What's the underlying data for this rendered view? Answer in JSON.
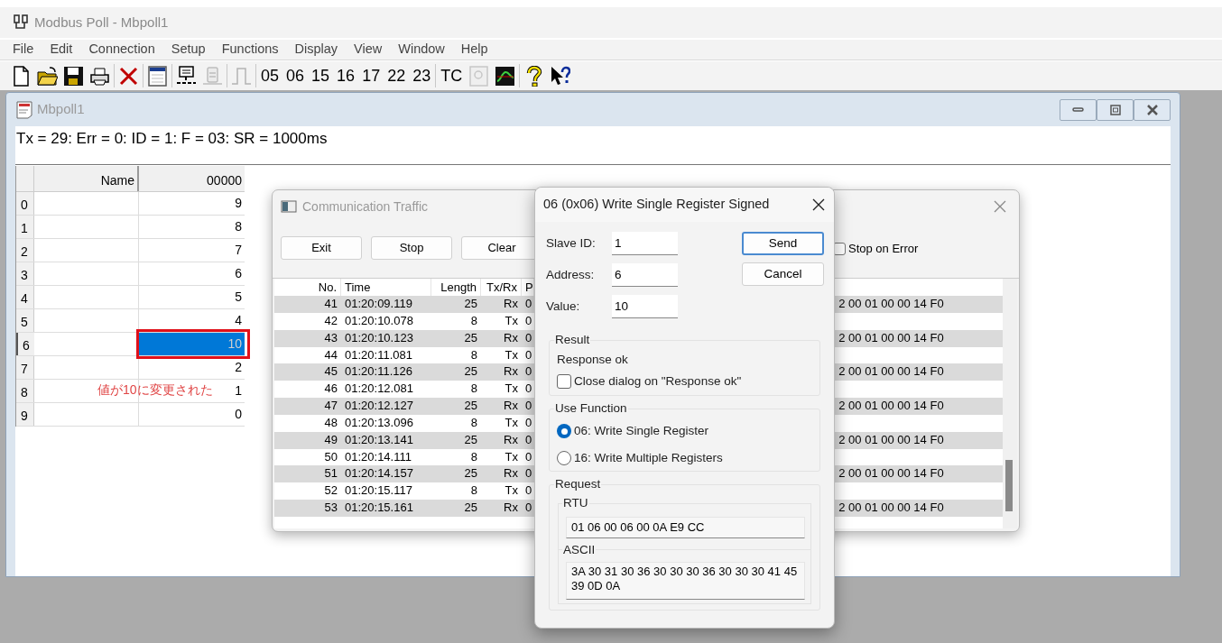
{
  "app": {
    "title": "Modbus Poll - Mbpoll1"
  },
  "menu": [
    "File",
    "Edit",
    "Connection",
    "Setup",
    "Functions",
    "Display",
    "View",
    "Window",
    "Help"
  ],
  "toolbar_groups": [
    {
      "items": [
        {
          "kind": "document",
          "disabled": false
        },
        {
          "kind": "folder",
          "disabled": false
        },
        {
          "kind": "disk",
          "disabled": false
        },
        {
          "kind": "printer",
          "disabled": false
        }
      ]
    },
    {
      "items": [
        {
          "kind": "delete",
          "disabled": false
        }
      ]
    },
    {
      "items": [
        {
          "kind": "window",
          "disabled": false
        }
      ]
    },
    {
      "items": [
        {
          "kind": "connect",
          "disabled": false
        },
        {
          "kind": "disconnect",
          "disabled": true
        }
      ]
    },
    {
      "items": [
        {
          "kind": "pulse",
          "disabled": true
        }
      ]
    },
    {
      "items": [
        {
          "kind": "code",
          "label": "05",
          "disabled": false
        },
        {
          "kind": "code",
          "label": "06",
          "disabled": false
        },
        {
          "kind": "code",
          "label": "15",
          "disabled": false
        },
        {
          "kind": "code",
          "label": "16",
          "disabled": false
        },
        {
          "kind": "code",
          "label": "17",
          "disabled": false
        },
        {
          "kind": "code",
          "label": "22",
          "disabled": false
        },
        {
          "kind": "code",
          "label": "23",
          "disabled": false
        }
      ]
    },
    {
      "items": [
        {
          "kind": "code",
          "label": "TC",
          "disabled": false
        },
        {
          "kind": "monitor",
          "disabled": true
        },
        {
          "kind": "chart",
          "disabled": false
        }
      ]
    },
    {
      "items": [
        {
          "kind": "help",
          "disabled": false
        },
        {
          "kind": "context-help",
          "disabled": false
        }
      ]
    }
  ],
  "poll_window": {
    "title": "Mbpoll1",
    "status": "Tx = 29: Err = 0: ID = 1: F = 03: SR = 1000ms",
    "columns": [
      "Name",
      "00000"
    ],
    "rows": [
      {
        "index": "0",
        "value": "9",
        "selected": false,
        "highlighted": false
      },
      {
        "index": "1",
        "value": "8",
        "selected": false,
        "highlighted": false
      },
      {
        "index": "2",
        "value": "7",
        "selected": false,
        "highlighted": false
      },
      {
        "index": "3",
        "value": "6",
        "selected": false,
        "highlighted": false
      },
      {
        "index": "4",
        "value": "5",
        "selected": false,
        "highlighted": false
      },
      {
        "index": "5",
        "value": "4",
        "selected": false,
        "highlighted": false
      },
      {
        "index": "6",
        "value": "10",
        "selected": true,
        "highlighted": true
      },
      {
        "index": "7",
        "value": "2",
        "selected": false,
        "highlighted": false
      },
      {
        "index": "8",
        "value": "1",
        "selected": false,
        "highlighted": false
      },
      {
        "index": "9",
        "value": "0",
        "selected": false,
        "highlighted": false
      }
    ],
    "annotation": "値が10に変更された"
  },
  "traffic_window": {
    "title": "Communication Traffic",
    "buttons": [
      "Exit",
      "Stop",
      "Clear"
    ],
    "stop_on_error": {
      "label": "Stop on Error",
      "checked": false
    },
    "columns": [
      "No.",
      "Time",
      "Length",
      "Tx/Rx",
      "P"
    ],
    "rows": [
      {
        "no": "41",
        "time": "01:20:09.119",
        "length": "25",
        "dir": "Rx",
        "payload_start": "0",
        "payload_end": "2 00 01 00 00 14 F0"
      },
      {
        "no": "42",
        "time": "01:20:10.078",
        "length": "8",
        "dir": "Tx",
        "payload_start": "0"
      },
      {
        "no": "43",
        "time": "01:20:10.123",
        "length": "25",
        "dir": "Rx",
        "payload_start": "0",
        "payload_end": "2 00 01 00 00 14 F0"
      },
      {
        "no": "44",
        "time": "01:20:11.081",
        "length": "8",
        "dir": "Tx",
        "payload_start": "0"
      },
      {
        "no": "45",
        "time": "01:20:11.126",
        "length": "25",
        "dir": "Rx",
        "payload_start": "0",
        "payload_end": "2 00 01 00 00 14 F0"
      },
      {
        "no": "46",
        "time": "01:20:12.081",
        "length": "8",
        "dir": "Tx",
        "payload_start": "0"
      },
      {
        "no": "47",
        "time": "01:20:12.127",
        "length": "25",
        "dir": "Rx",
        "payload_start": "0",
        "payload_end": "2 00 01 00 00 14 F0"
      },
      {
        "no": "48",
        "time": "01:20:13.096",
        "length": "8",
        "dir": "Tx",
        "payload_start": "0"
      },
      {
        "no": "49",
        "time": "01:20:13.141",
        "length": "25",
        "dir": "Rx",
        "payload_start": "0",
        "payload_end": "2 00 01 00 00 14 F0"
      },
      {
        "no": "50",
        "time": "01:20:14.111",
        "length": "8",
        "dir": "Tx",
        "payload_start": "0"
      },
      {
        "no": "51",
        "time": "01:20:14.157",
        "length": "25",
        "dir": "Rx",
        "payload_start": "0",
        "payload_end": "2 00 01 00 00 14 F0"
      },
      {
        "no": "52",
        "time": "01:20:15.117",
        "length": "8",
        "dir": "Tx",
        "payload_start": "0"
      },
      {
        "no": "53",
        "time": "01:20:15.161",
        "length": "25",
        "dir": "Rx",
        "payload_start": "0",
        "payload_end": "2 00 01 00 00 14 F0"
      }
    ]
  },
  "dialog": {
    "title": "06 (0x06) Write Single Register Signed",
    "fields": [
      {
        "label": "Slave ID:",
        "value": "1"
      },
      {
        "label": "Address:",
        "value": "6"
      },
      {
        "label": "Value:",
        "value": "10"
      }
    ],
    "buttons": [
      {
        "label": "Send",
        "focused": true
      },
      {
        "label": "Cancel",
        "focused": false
      }
    ],
    "result": {
      "title": "Result",
      "message": "Response ok",
      "close_on_ok": {
        "label": "Close dialog on \"Response ok\"",
        "checked": false
      }
    },
    "use_function": {
      "title": "Use Function",
      "options": [
        {
          "label": "06: Write Single Register",
          "selected": true
        },
        {
          "label": "16: Write Multiple Registers",
          "selected": false
        }
      ]
    },
    "request": {
      "title": "Request",
      "rtu": {
        "title": "RTU",
        "value": "01 06 00 06 00 0A E9 CC"
      },
      "ascii": {
        "title": "ASCII",
        "value": "3A 30 31 30 36 30 30 30 36 30 30 30 41 45 39 0D 0A"
      }
    }
  }
}
